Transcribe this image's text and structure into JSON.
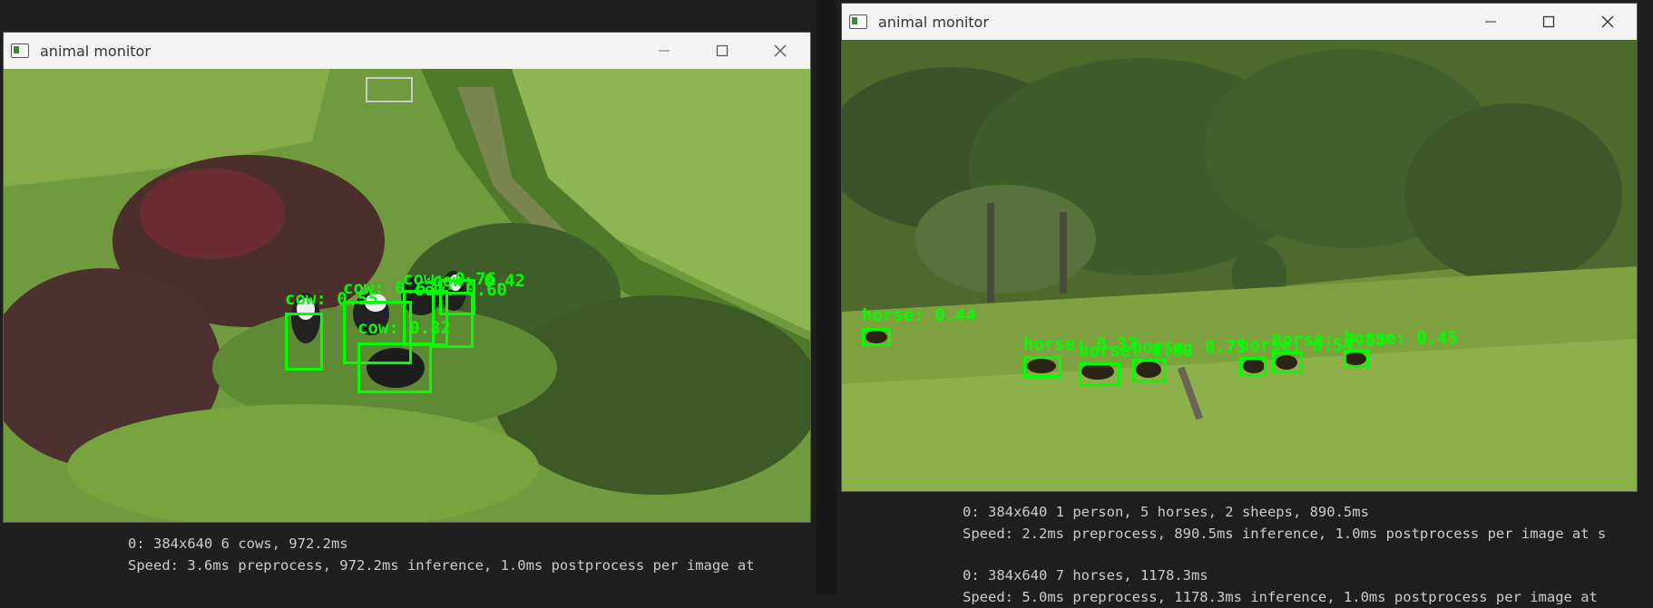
{
  "left_window": {
    "title": "animal monitor",
    "detections": [
      {
        "label": "cow: 0.55"
      },
      {
        "label": "cow: 0.63"
      },
      {
        "label": "cow: 0.82"
      },
      {
        "label": "cow: 0.76"
      },
      {
        "label": "cow: 0.42"
      },
      {
        "label": "cow: 0.60"
      }
    ]
  },
  "right_window": {
    "title": "animal monitor",
    "detections": [
      {
        "label": "horse: 0.44"
      },
      {
        "label": "horse: 0.37"
      },
      {
        "label": "horse: 0.80"
      },
      {
        "label": "horse: 0.75"
      },
      {
        "label": "horse: 0.54"
      },
      {
        "label": "horse: 0.53"
      },
      {
        "label": "horse: 0.45"
      }
    ]
  },
  "terminal_left": {
    "line1": "0: 384x640 6 cows, 972.2ms",
    "line2": "Speed: 3.6ms preprocess, 972.2ms inference, 1.0ms postprocess per image at"
  },
  "terminal_right": {
    "line1": "0: 384x640 1 person, 5 horses, 2 sheeps, 890.5ms",
    "line2": "Speed: 2.2ms preprocess, 890.5ms inference, 1.0ms postprocess per image at s",
    "line3": "0: 384x640 7 horses, 1178.3ms",
    "line4": "Speed: 5.0ms preprocess, 1178.3ms inference, 1.0ms postprocess per image at"
  }
}
